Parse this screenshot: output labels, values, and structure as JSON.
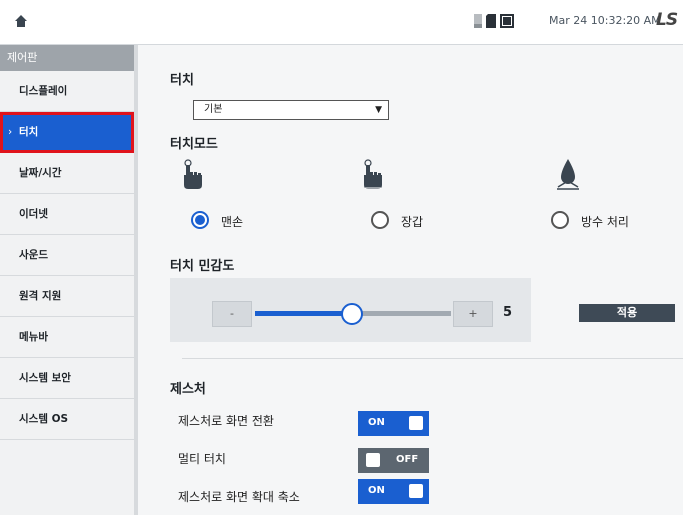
{
  "topbar": {
    "home_icon": "home-icon",
    "status_icons": [
      "storage-icon",
      "sd-card-icon",
      "display-icon"
    ],
    "datetime": "Mar 24 10:32:20 AM",
    "logo_text": "LS"
  },
  "sidebar": {
    "header": "제어판",
    "items": [
      {
        "label": "디스플레이",
        "active": false
      },
      {
        "label": "터치",
        "active": true
      },
      {
        "label": "날짜/시간",
        "active": false
      },
      {
        "label": "이더넷",
        "active": false
      },
      {
        "label": "사운드",
        "active": false
      },
      {
        "label": "원격 지원",
        "active": false
      },
      {
        "label": "메뉴바",
        "active": false
      },
      {
        "label": "시스템 보안",
        "active": false
      },
      {
        "label": "시스템 OS",
        "active": false
      }
    ],
    "active_chevron": "›"
  },
  "touch": {
    "title": "터치",
    "select_value": "기본",
    "select_arrow": "▼"
  },
  "touch_mode": {
    "title": "터치모드",
    "options": [
      {
        "label": "맨손",
        "icon": "bare-hand-touch-icon",
        "selected": true
      },
      {
        "label": "장갑",
        "icon": "glove-touch-icon",
        "selected": false
      },
      {
        "label": "방수 처리",
        "icon": "water-drop-icon",
        "selected": false
      }
    ]
  },
  "sensitivity": {
    "title": "터치 민감도",
    "minus": "-",
    "plus": "+",
    "value": "5",
    "level_fraction": 0.5,
    "apply": "적용"
  },
  "gesture": {
    "title": "제스처",
    "rows": [
      {
        "label": "제스처로 화면 전환",
        "state": "ON"
      },
      {
        "label": "멀티 터치",
        "state": "OFF"
      },
      {
        "label": "제스처로 화면 확대 축소",
        "state": "ON"
      }
    ]
  },
  "colors": {
    "accent": "#1a5fd0",
    "highlight": "#e0131b",
    "dark_button": "#3e4a56"
  }
}
